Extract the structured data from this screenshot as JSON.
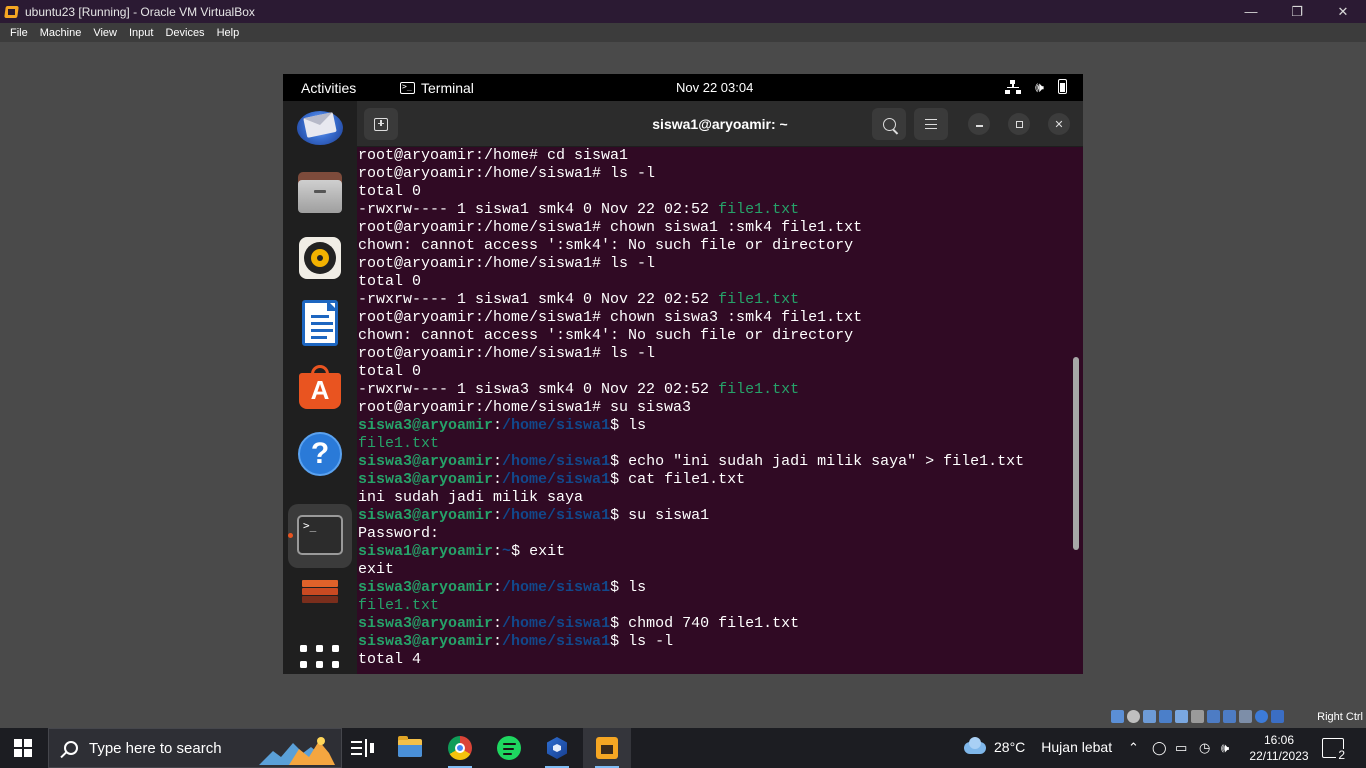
{
  "vbox": {
    "title": "ubuntu23 [Running] - Oracle VM VirtualBox",
    "menu": [
      "File",
      "Machine",
      "View",
      "Input",
      "Devices",
      "Help"
    ],
    "host_key": "Right Ctrl"
  },
  "gnome": {
    "activities": "Activities",
    "app_name": "Terminal",
    "clock": "Nov 22  03:04"
  },
  "dock_apps": [
    "thunderbird-icon",
    "files-icon",
    "rhythmbox-icon",
    "libreoffice-writer-icon",
    "ubuntu-software-icon",
    "help-icon",
    "terminal-icon",
    "stack-icon",
    "show-apps-icon"
  ],
  "terminal": {
    "title": "siswa1@aryoamir: ~",
    "lines": [
      [
        {
          "t": "root@aryoamir:/home# cd siswa1"
        }
      ],
      [
        {
          "t": "root@aryoamir:/home/siswa1# ls -l"
        }
      ],
      [
        {
          "t": "total 0"
        }
      ],
      [
        {
          "t": "-rwxrw---- 1 siswa1 smk4 0 Nov 22 02:52 "
        },
        {
          "t": "file1.txt",
          "c": "file"
        }
      ],
      [
        {
          "t": "root@aryoamir:/home/siswa1# chown siswa1 :smk4 file1.txt"
        }
      ],
      [
        {
          "t": "chown: cannot access ':smk4': No such file or directory"
        }
      ],
      [
        {
          "t": "root@aryoamir:/home/siswa1# ls -l"
        }
      ],
      [
        {
          "t": "total 0"
        }
      ],
      [
        {
          "t": "-rwxrw---- 1 siswa1 smk4 0 Nov 22 02:52 "
        },
        {
          "t": "file1.txt",
          "c": "file"
        }
      ],
      [
        {
          "t": "root@aryoamir:/home/siswa1# chown siswa3 :smk4 file1.txt"
        }
      ],
      [
        {
          "t": "chown: cannot access ':smk4': No such file or directory"
        }
      ],
      [
        {
          "t": "root@aryoamir:/home/siswa1# ls -l"
        }
      ],
      [
        {
          "t": "total 0"
        }
      ],
      [
        {
          "t": "-rwxrw---- 1 siswa3 smk4 0 Nov 22 02:52 "
        },
        {
          "t": "file1.txt",
          "c": "file"
        }
      ],
      [
        {
          "t": "root@aryoamir:/home/siswa1# su siswa3"
        }
      ],
      [
        {
          "t": "siswa3@aryoamir",
          "c": "user"
        },
        {
          "t": ":"
        },
        {
          "t": "/home/siswa1",
          "c": "path"
        },
        {
          "t": "$ ls"
        }
      ],
      [
        {
          "t": "file1.txt",
          "c": "file"
        }
      ],
      [
        {
          "t": "siswa3@aryoamir",
          "c": "user"
        },
        {
          "t": ":"
        },
        {
          "t": "/home/siswa1",
          "c": "path"
        },
        {
          "t": "$ echo \"ini sudah jadi milik saya\" > file1.txt"
        }
      ],
      [
        {
          "t": "siswa3@aryoamir",
          "c": "user"
        },
        {
          "t": ":"
        },
        {
          "t": "/home/siswa1",
          "c": "path"
        },
        {
          "t": "$ cat file1.txt"
        }
      ],
      [
        {
          "t": "ini sudah jadi milik saya"
        }
      ],
      [
        {
          "t": "siswa3@aryoamir",
          "c": "user"
        },
        {
          "t": ":"
        },
        {
          "t": "/home/siswa1",
          "c": "path"
        },
        {
          "t": "$ su siswa1"
        }
      ],
      [
        {
          "t": "Password:"
        }
      ],
      [
        {
          "t": "siswa1@aryoamir",
          "c": "user"
        },
        {
          "t": ":"
        },
        {
          "t": "~",
          "c": "path"
        },
        {
          "t": "$ exit"
        }
      ],
      [
        {
          "t": "exit"
        }
      ],
      [
        {
          "t": "siswa3@aryoamir",
          "c": "user"
        },
        {
          "t": ":"
        },
        {
          "t": "/home/siswa1",
          "c": "path"
        },
        {
          "t": "$ ls"
        }
      ],
      [
        {
          "t": "file1.txt",
          "c": "file"
        }
      ],
      [
        {
          "t": "siswa3@aryoamir",
          "c": "user"
        },
        {
          "t": ":"
        },
        {
          "t": "/home/siswa1",
          "c": "path"
        },
        {
          "t": "$ chmod 740 file1.txt"
        }
      ],
      [
        {
          "t": "siswa3@aryoamir",
          "c": "user"
        },
        {
          "t": ":"
        },
        {
          "t": "/home/siswa1",
          "c": "path"
        },
        {
          "t": "$ ls -l"
        }
      ],
      [
        {
          "t": "total 4"
        }
      ]
    ]
  },
  "taskbar": {
    "search_placeholder": "Type here to search",
    "weather_temp": "28°C",
    "weather_condition": "Hujan lebat",
    "time": "16:06",
    "date": "22/11/2023",
    "notification_count": "2"
  },
  "colors": {
    "terminal_bg": "#300a24",
    "prompt_user": "#26a269",
    "prompt_path": "#12488b",
    "ubuntu_orange": "#e95420"
  }
}
